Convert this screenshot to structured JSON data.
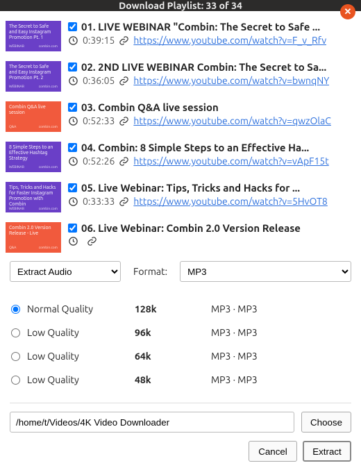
{
  "window": {
    "title": "Download Playlist: 33 of 34"
  },
  "thumb_labels": {
    "webinar": "WEBINAR",
    "qa": "Q&A",
    "brand": "combin.com"
  },
  "items": [
    {
      "thumb_bg": "thumb-purple",
      "thumb_text": "The Secret to Safe and Easy Instagram Promotion Pt. 1",
      "title": "01. LIVE WEBINAR \"Combin: The Secret to Safe ...",
      "duration": "0:39:15",
      "url": "https://www.youtube.com/watch?v=F_v_Rfv"
    },
    {
      "thumb_bg": "thumb-purple",
      "thumb_text": "The Secret to Safe and Easy Instagram Promotion Pt. 2",
      "title": "02. 2ND LIVE WEBINAR Combin: The Secret to Sa...",
      "duration": "0:36:05",
      "url": "https://www.youtube.com/watch?v=bwnqNY"
    },
    {
      "thumb_bg": "thumb-orange",
      "thumb_text": "Combin Q&A live session",
      "title": "03. Combin Q&A live session",
      "duration": "0:52:33",
      "url": "https://www.youtube.com/watch?v=qwzOlaC"
    },
    {
      "thumb_bg": "thumb-purple",
      "thumb_text": "8 Simple Steps to an Effective Hashtag Strategy",
      "title": "04. Combin: 8 Simple Steps to an Effective Ha...",
      "duration": "0:52:26",
      "url": "https://www.youtube.com/watch?v=vApF15t"
    },
    {
      "thumb_bg": "thumb-purple",
      "thumb_text": "Tips, Tricks and Hacks for Faster Instagram Promotion with Combin",
      "title": "05. Live Webinar: Tips, Tricks and Hacks for ...",
      "duration": "0:33:33",
      "url": "https://www.youtube.com/watch?v=5HvOT8"
    },
    {
      "thumb_bg": "thumb-orange",
      "thumb_text": "Combin 2.0 Version Release - Live",
      "title": "06. Live Webinar: Combin 2.0 Version Release",
      "duration": "",
      "url": ""
    }
  ],
  "controls": {
    "action_select": "Extract Audio",
    "format_label": "Format:",
    "format_select": "MP3"
  },
  "qualities": [
    {
      "name": "Normal Quality",
      "bitrate": "128k",
      "codec": "MP3 · MP3",
      "selected": true
    },
    {
      "name": "Low Quality",
      "bitrate": "96k",
      "codec": "MP3 · MP3",
      "selected": false
    },
    {
      "name": "Low Quality",
      "bitrate": "64k",
      "codec": "MP3 · MP3",
      "selected": false
    },
    {
      "name": "Low Quality",
      "bitrate": "48k",
      "codec": "MP3 · MP3",
      "selected": false
    }
  ],
  "path": {
    "value": "/home/t/Videos/4K Video Downloader",
    "choose_label": "Choose"
  },
  "footer": {
    "cancel_label": "Cancel",
    "extract_label": "Extract"
  }
}
